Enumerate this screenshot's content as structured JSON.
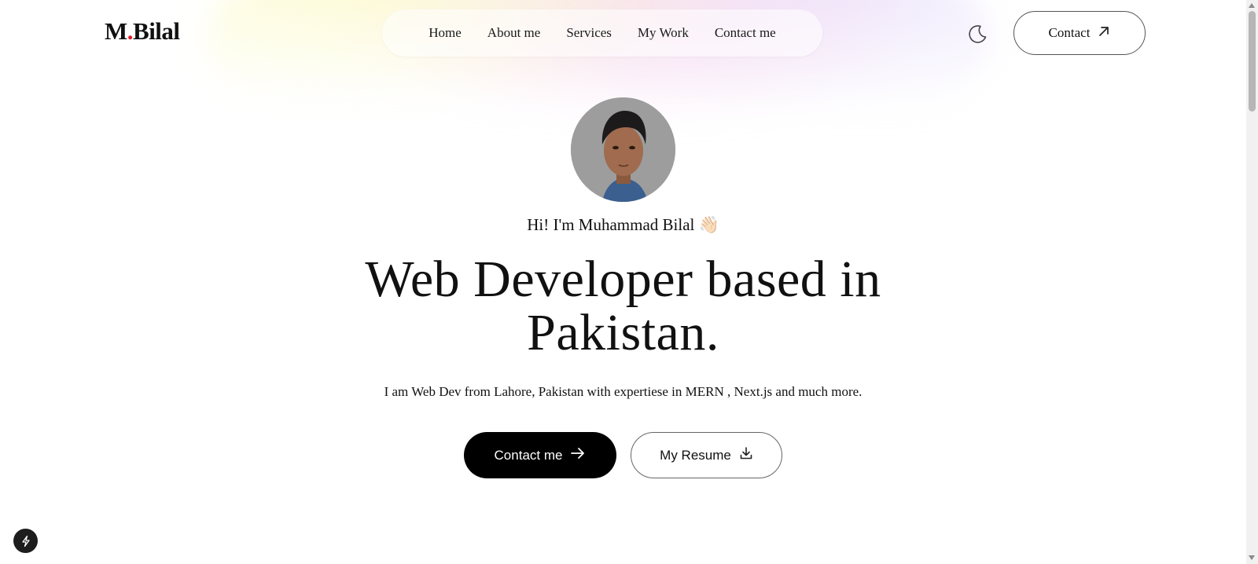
{
  "header": {
    "logo_prefix": "M",
    "logo_dot": ".",
    "logo_suffix": "Bilal",
    "nav": [
      {
        "label": "Home"
      },
      {
        "label": "About me"
      },
      {
        "label": "Services"
      },
      {
        "label": "My Work"
      },
      {
        "label": "Contact me"
      }
    ],
    "theme_toggle_icon": "moon-icon",
    "contact_label": "Contact",
    "contact_icon": "arrow-up-right-icon"
  },
  "hero": {
    "avatar_icon": "profile-photo",
    "greeting": "Hi! I'm Muhammad Bilal",
    "greeting_emoji": "👋🏻",
    "headline_line1": "Web Developer based in",
    "headline_line2": "Pakistan.",
    "subtext": "I am Web Dev from Lahore, Pakistan with expertiese in MERN , Next.js and much more.",
    "primary_cta": "Contact me",
    "primary_cta_icon": "arrow-right-icon",
    "secondary_cta": "My Resume",
    "secondary_cta_icon": "download-icon"
  },
  "floating_badge_icon": "lightning-icon",
  "colors": {
    "accent_dot": "#e11d2a",
    "primary_button": "#000000",
    "text": "#111111"
  }
}
